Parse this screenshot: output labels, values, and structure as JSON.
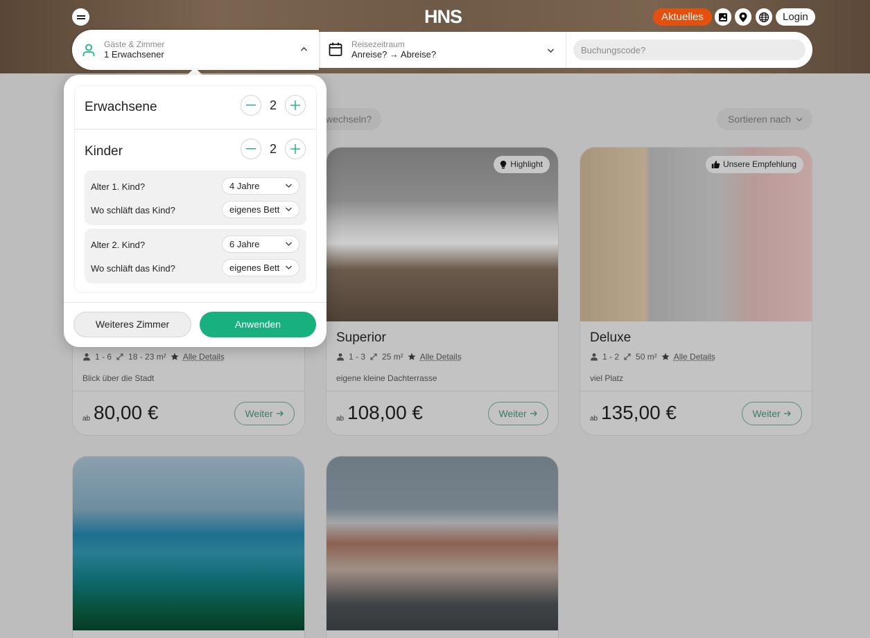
{
  "header": {
    "logo": "HNS",
    "news_label": "Aktuelles",
    "login_label": "Login"
  },
  "search": {
    "guests_label": "Gäste & Zimmer",
    "guests_value": "1 Erwachsener",
    "period_label": "Reisezeitraum",
    "period_value": "Anreise? → Abreise?",
    "booking_placeholder": "Buchungscode?"
  },
  "filters": {
    "change_label": "wechseln?",
    "sort_label": "Sortieren nach"
  },
  "rooms": [
    {
      "meta_persons": "1 - 6",
      "meta_size": "18 - 23 m²",
      "details": "Alle Details",
      "description": "Blick über die Stadt",
      "price_prefix": "ab",
      "price": "80,00 €",
      "next_label": "Weiter"
    },
    {
      "badge": "Highlight",
      "name": "Superior",
      "meta_persons": "1 - 3",
      "meta_size": "25 m²",
      "details": "Alle Details",
      "description": "eigene kleine Dachterrasse",
      "price_prefix": "ab",
      "price": "108,00 €",
      "next_label": "Weiter"
    },
    {
      "badge": "Unsere Empfehlung",
      "name": "Deluxe",
      "meta_persons": "1 - 2",
      "meta_size": "50 m²",
      "details": "Alle Details",
      "description": "viel Platz",
      "price_prefix": "ab",
      "price": "135,00 €",
      "next_label": "Weiter"
    }
  ],
  "popup": {
    "adults_label": "Erwachsene",
    "adults_count": "2",
    "children_label": "Kinder",
    "children_count": "2",
    "children": [
      {
        "age_label": "Alter 1. Kind?",
        "age_value": "4 Jahre",
        "bed_label": "Wo schläft das Kind?",
        "bed_value": "eigenes Bett"
      },
      {
        "age_label": "Alter 2. Kind?",
        "age_value": "6 Jahre",
        "bed_label": "Wo schläft das Kind?",
        "bed_value": "eigenes Bett"
      }
    ],
    "more_room_label": "Weiteres Zimmer",
    "apply_label": "Anwenden"
  },
  "colors": {
    "accent": "#17b07e",
    "news": "#e5500f"
  },
  "icons": [
    "menu-icon",
    "image-icon",
    "location-pin-icon",
    "globe-icon",
    "person-icon",
    "calendar-icon",
    "chevron-up-icon",
    "chevron-down-icon",
    "minus-icon",
    "plus-icon",
    "lightbulb-icon",
    "thumbs-up-icon",
    "guests-icon",
    "resize-icon",
    "star-icon",
    "arrow-right-icon"
  ]
}
